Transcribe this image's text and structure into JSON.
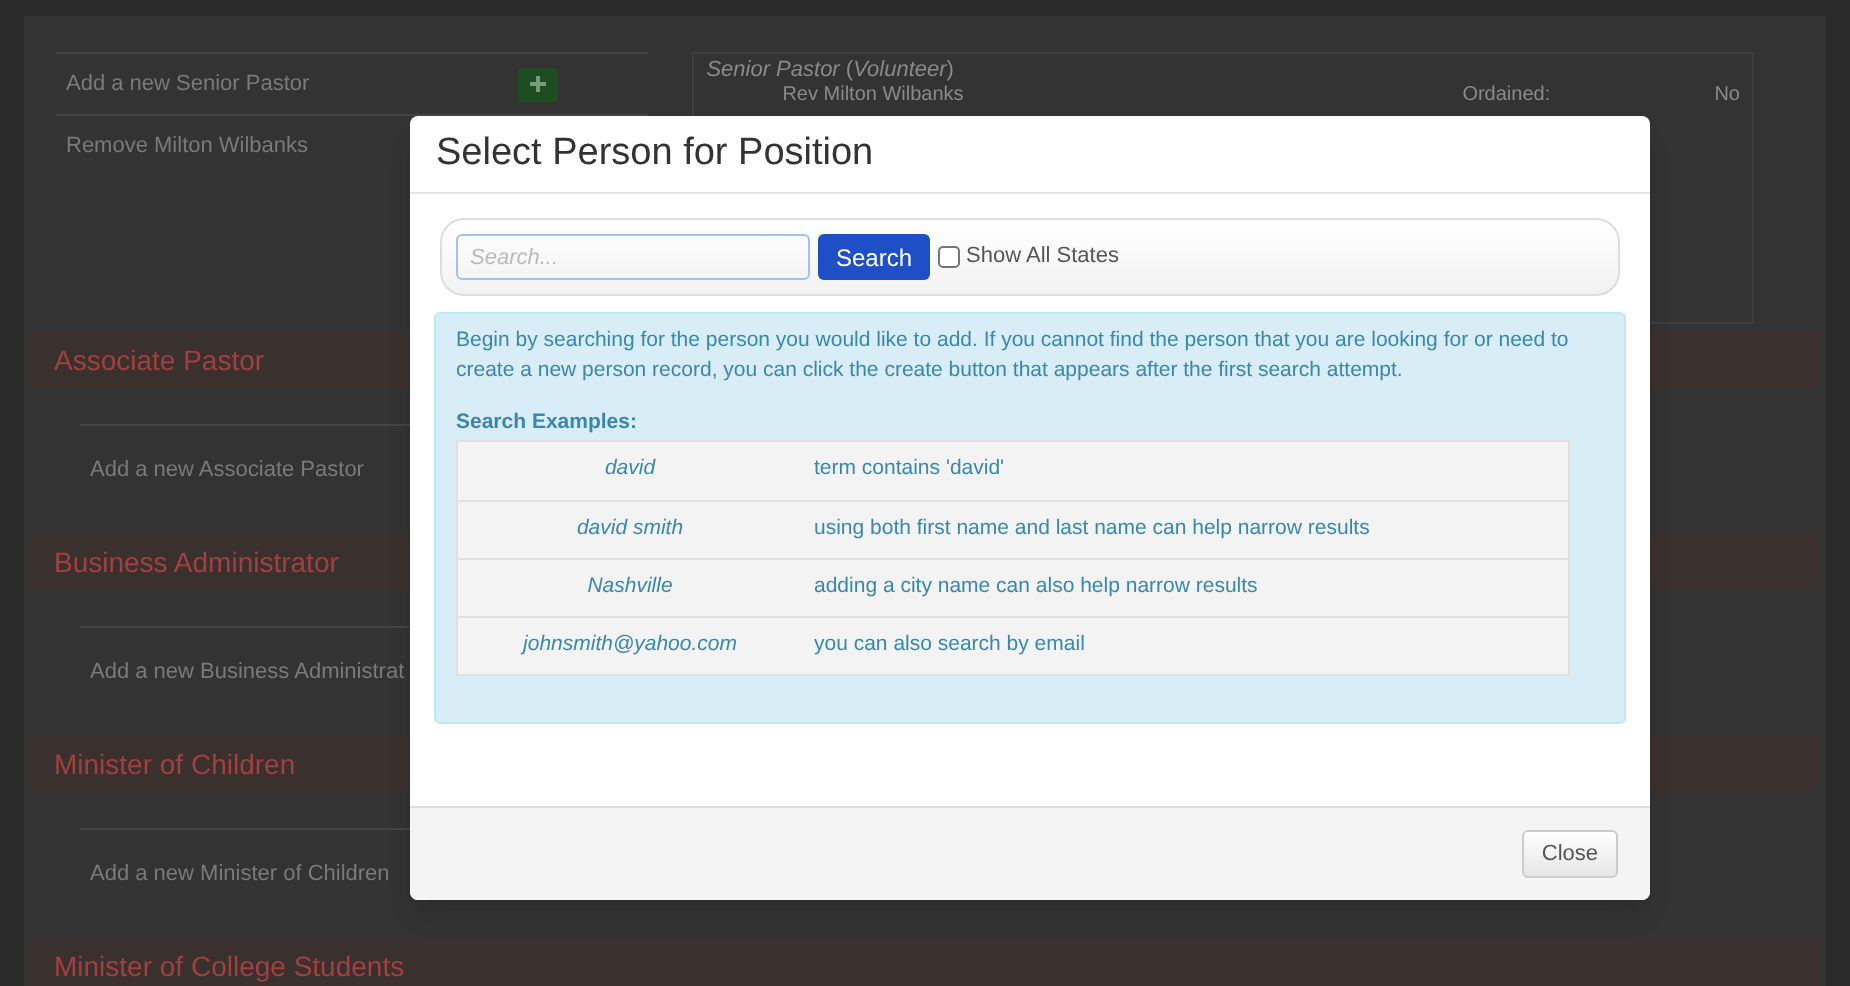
{
  "background": {
    "top_actions": [
      {
        "label": "Add a new Senior Pastor",
        "has_add": true
      },
      {
        "label": "Remove Milton Wilbanks"
      }
    ],
    "position_card": {
      "heading": "*Senior Pastor* (*Volunteer*)",
      "name": "Rev Milton Wilbanks",
      "field_label": "Ordained:",
      "field_value": "No"
    },
    "sections": [
      {
        "title": "Associate Pastor",
        "action": "Add a new Associate Pastor"
      },
      {
        "title": "Business Administrator",
        "action": "Add a new Business Administrat"
      },
      {
        "title": "Minister of Children",
        "action": "Add a new Minister of Children"
      },
      {
        "title": "Minister of College Students"
      }
    ]
  },
  "modal": {
    "title": "Select Person for Position",
    "search": {
      "placeholder": "Search...",
      "button": "Search",
      "checkbox_label": "Show All States",
      "checked": false
    },
    "info": "Begin by searching for the person you would like to add. If you cannot find the person that you are looking for or need to create a new person record, you can click the create button that appears after the first search attempt.",
    "examples_heading": "Search Examples:",
    "examples": [
      {
        "term": "david",
        "description": "term contains 'david'"
      },
      {
        "term": "david smith",
        "description": "using both first name and last name can help narrow results"
      },
      {
        "term": "Nashville",
        "description": "adding a city name can also help narrow results"
      },
      {
        "term": "johnsmith@yahoo.com",
        "description": "you can also search by email"
      }
    ],
    "close_button": "Close"
  }
}
